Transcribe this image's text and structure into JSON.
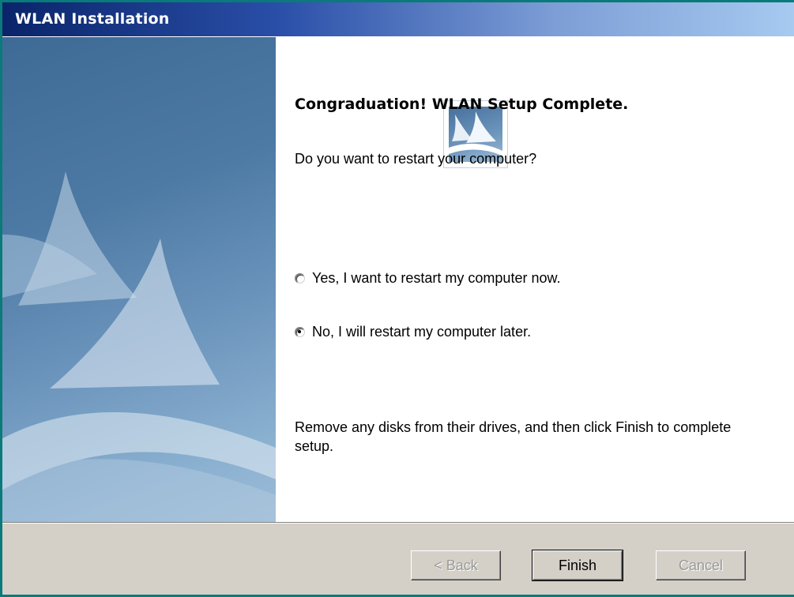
{
  "window": {
    "title": "WLAN Installation"
  },
  "content": {
    "heading": "Congraduation! WLAN Setup Complete.",
    "question": "Do you want to restart your computer?",
    "options": [
      {
        "label": "Yes, I want to restart my computer now.",
        "selected": false
      },
      {
        "label": "No, I will restart my computer later.",
        "selected": true
      }
    ],
    "note": "Remove any disks from their drives, and then click Finish to complete setup."
  },
  "buttons": {
    "back_label": "< Back",
    "back_enabled": false,
    "finish_label": "Finish",
    "cancel_label": "Cancel",
    "cancel_enabled": false
  },
  "icons": {
    "logo": "sail-logo-icon",
    "banner": "sails-banner-image"
  },
  "colors": {
    "titlebar_start": "#0a246a",
    "titlebar_end": "#a6caf0",
    "panel_blue": "#4d7aa4",
    "dialog_face": "#d4d0c8"
  }
}
